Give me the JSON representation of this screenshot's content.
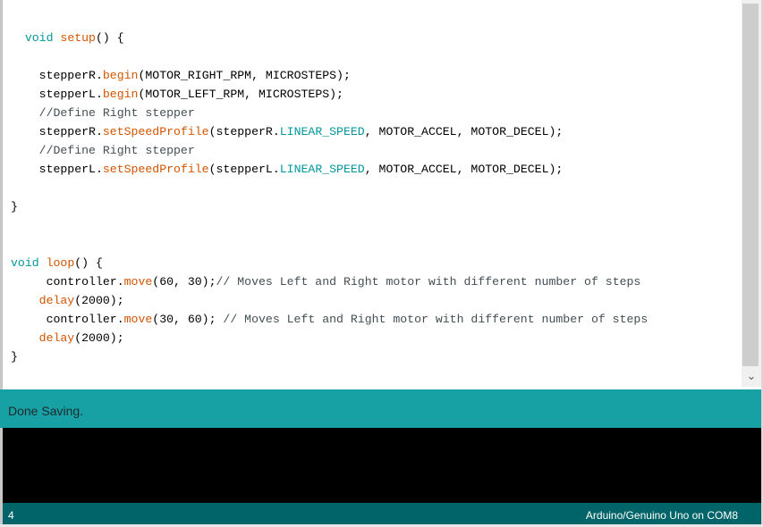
{
  "editor": {
    "lines": [
      {
        "segments": [
          {
            "t": "  "
          },
          {
            "t": "void",
            "c": "kw"
          },
          {
            "t": " "
          },
          {
            "t": "setup",
            "c": "fn"
          },
          {
            "t": "() {"
          }
        ]
      },
      {
        "segments": []
      },
      {
        "segments": [
          {
            "t": "    stepperR."
          },
          {
            "t": "begin",
            "c": "fn"
          },
          {
            "t": "(MOTOR_RIGHT_RPM, MICROSTEPS);"
          }
        ]
      },
      {
        "segments": [
          {
            "t": "    stepperL."
          },
          {
            "t": "begin",
            "c": "fn"
          },
          {
            "t": "(MOTOR_LEFT_RPM, MICROSTEPS);"
          }
        ]
      },
      {
        "segments": [
          {
            "t": "    "
          },
          {
            "t": "//Define Right stepper",
            "c": "cm"
          }
        ]
      },
      {
        "segments": [
          {
            "t": "    stepperR."
          },
          {
            "t": "setSpeedProfile",
            "c": "fn"
          },
          {
            "t": "(stepperR."
          },
          {
            "t": "LINEAR_SPEED",
            "c": "kw"
          },
          {
            "t": ", MOTOR_ACCEL, MOTOR_DECEL);"
          }
        ]
      },
      {
        "segments": [
          {
            "t": "    "
          },
          {
            "t": "//Define Right stepper",
            "c": "cm"
          }
        ]
      },
      {
        "segments": [
          {
            "t": "    stepperL."
          },
          {
            "t": "setSpeedProfile",
            "c": "fn"
          },
          {
            "t": "(stepperL."
          },
          {
            "t": "LINEAR_SPEED",
            "c": "kw"
          },
          {
            "t": ", MOTOR_ACCEL, MOTOR_DECEL);"
          }
        ]
      },
      {
        "segments": []
      },
      {
        "segments": [
          {
            "t": "}"
          }
        ]
      },
      {
        "segments": []
      },
      {
        "segments": []
      },
      {
        "segments": [
          {
            "t": "void",
            "c": "kw"
          },
          {
            "t": " "
          },
          {
            "t": "loop",
            "c": "fn"
          },
          {
            "t": "() {"
          }
        ]
      },
      {
        "segments": [
          {
            "t": "     controller."
          },
          {
            "t": "move",
            "c": "fn"
          },
          {
            "t": "(60, 30);"
          },
          {
            "t": "// Moves Left and Right motor with different number of steps",
            "c": "cm"
          }
        ]
      },
      {
        "segments": [
          {
            "t": "    "
          },
          {
            "t": "delay",
            "c": "fn"
          },
          {
            "t": "(2000);"
          }
        ]
      },
      {
        "segments": [
          {
            "t": "     controller."
          },
          {
            "t": "move",
            "c": "fn"
          },
          {
            "t": "(30, 60); "
          },
          {
            "t": "// Moves Left and Right motor with different number of steps",
            "c": "cm"
          }
        ]
      },
      {
        "segments": [
          {
            "t": "    "
          },
          {
            "t": "delay",
            "c": "fn"
          },
          {
            "t": "(2000);"
          }
        ]
      },
      {
        "segments": [
          {
            "t": "}"
          }
        ]
      }
    ]
  },
  "status": {
    "message": "Done Saving."
  },
  "footer": {
    "line_number": "4",
    "board": "Arduino/Genuino Uno on COM8"
  },
  "icons": {
    "scroll_down": "chevron-down-icon"
  },
  "colors": {
    "keyword": "#00979c",
    "function": "#d35400",
    "comment": "#434f54",
    "status_bar": "#17a1a5",
    "footer_bar": "#006468",
    "console": "#000000"
  }
}
